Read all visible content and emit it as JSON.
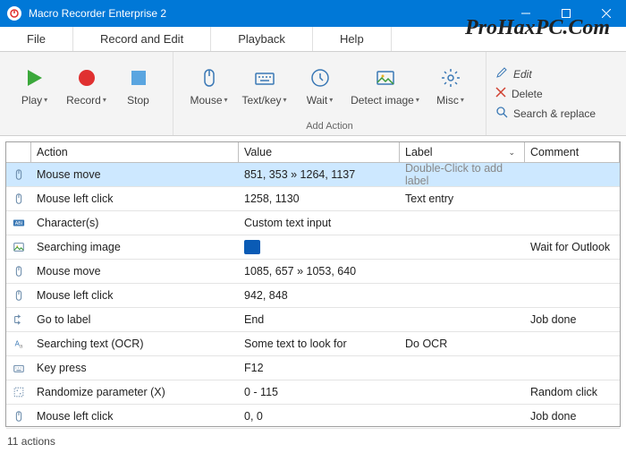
{
  "window": {
    "title": "Macro Recorder Enterprise 2"
  },
  "menu": {
    "file": "File",
    "record": "Record and Edit",
    "playback": "Playback",
    "help": "Help"
  },
  "watermark": "ProHaxPC.Com",
  "ribbon": {
    "play": "Play",
    "record": "Record",
    "stop": "Stop",
    "mouse": "Mouse",
    "textkey": "Text/key",
    "wait": "Wait",
    "detect": "Detect image",
    "misc": "Misc",
    "addaction": "Add Action",
    "edit": "Edit",
    "delete": "Delete",
    "search": "Search & replace"
  },
  "grid": {
    "headers": {
      "action": "Action",
      "value": "Value",
      "label": "Label",
      "comment": "Comment"
    },
    "rows": [
      {
        "icon": "mouse",
        "action": "Mouse move",
        "value": "851, 353 » 1264, 1137",
        "label": "Double-Click to add label",
        "labelPlaceholder": true,
        "comment": "",
        "selected": true
      },
      {
        "icon": "mouse",
        "action": "Mouse left click",
        "value": "1258, 1130",
        "label": "Text entry",
        "comment": ""
      },
      {
        "icon": "abi",
        "action": "Character(s)",
        "value": "Custom text input",
        "label": "",
        "comment": ""
      },
      {
        "icon": "image",
        "action": "Searching image",
        "value": "__img__",
        "label": "",
        "comment": "Wait for Outlook"
      },
      {
        "icon": "mouse",
        "action": "Mouse move",
        "value": "1085, 657 » 1053, 640",
        "label": "",
        "comment": ""
      },
      {
        "icon": "mouse",
        "action": "Mouse left click",
        "value": "942, 848",
        "label": "",
        "comment": ""
      },
      {
        "icon": "goto",
        "action": "Go to label",
        "value": "End",
        "label": "",
        "comment": "Job done"
      },
      {
        "icon": "ocr",
        "action": "Searching text (OCR)",
        "value": "Some text to look for",
        "label": "Do OCR",
        "comment": ""
      },
      {
        "icon": "key",
        "action": "Key press",
        "value": "F12",
        "label": "",
        "comment": ""
      },
      {
        "icon": "random",
        "action": "Randomize parameter (X)",
        "value": "0 - 115",
        "label": "",
        "comment": "Random click"
      },
      {
        "icon": "mouse",
        "action": "Mouse left click",
        "value": "0, 0",
        "label": "",
        "comment": "Job done"
      }
    ]
  },
  "status": "11 actions"
}
